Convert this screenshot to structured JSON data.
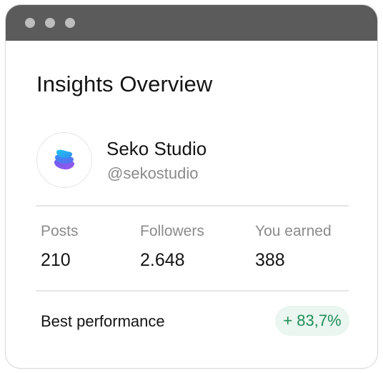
{
  "window": {
    "titlebar_color": "#5b5b5b",
    "controls": [
      "window-dot",
      "window-dot",
      "window-dot"
    ]
  },
  "page": {
    "title": "Insights Overview"
  },
  "profile": {
    "name": "Seko Studio",
    "handle": "@sekostudio",
    "avatar_icon": "layered-stack-logo"
  },
  "stats": [
    {
      "label": "Posts",
      "value": "210"
    },
    {
      "label": "Followers",
      "value": "2.648"
    },
    {
      "label": "You earned",
      "value": "388"
    }
  ],
  "performance": {
    "label": "Best performance",
    "value": "+ 83,7%",
    "color": "#1f8d5a",
    "badge_bg": "#eaf6ef"
  }
}
